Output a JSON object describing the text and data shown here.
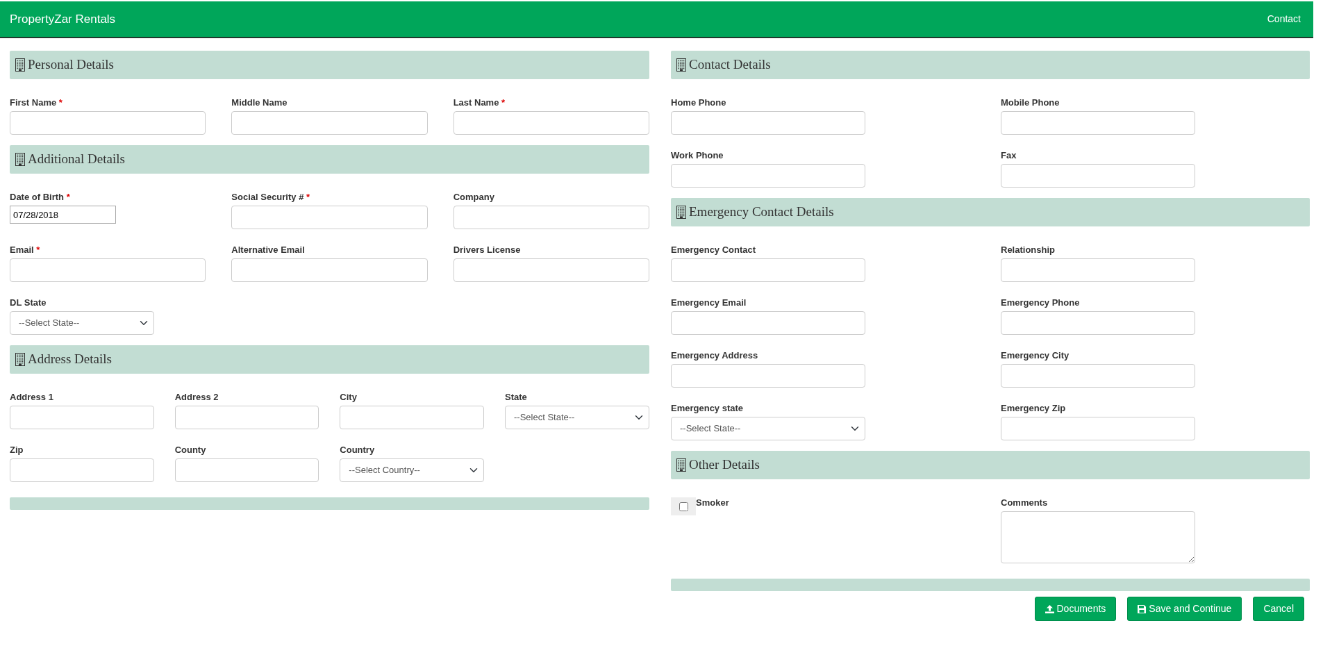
{
  "navbar": {
    "brand": "PropertyZar Rentals",
    "links": [
      "Contact"
    ]
  },
  "left_sections": [
    {
      "title": "Personal Details",
      "rows": [
        [
          {
            "kind": "text",
            "label": "First Name",
            "required_mark": "*"
          },
          {
            "kind": "text",
            "label": "Middle Name"
          },
          {
            "kind": "text",
            "label": "Last Name",
            "required_mark": "*"
          }
        ]
      ]
    },
    {
      "title": "Additional Details",
      "rows": [
        [
          {
            "kind": "date",
            "label": "Date of Birth",
            "required_mark": "*",
            "value": "07/28/2018"
          },
          {
            "kind": "text",
            "label": "Social Security #",
            "required_mark": "*"
          },
          {
            "kind": "text",
            "label": "Company"
          }
        ],
        [
          {
            "kind": "text",
            "label": "Email",
            "required_mark": "*"
          },
          {
            "kind": "text",
            "label": "Alternative Email"
          },
          {
            "kind": "text",
            "label": "Drivers License"
          }
        ],
        [
          {
            "kind": "select",
            "label": "DL State",
            "value": "--Select State--"
          }
        ]
      ]
    },
    {
      "title": "Address Details",
      "rows": [
        [
          {
            "kind": "text",
            "label": "Address 1"
          },
          {
            "kind": "text",
            "label": "Address 2"
          },
          {
            "kind": "text",
            "label": "City"
          },
          {
            "kind": "select",
            "label": "State",
            "value": "--Select State--"
          }
        ],
        [
          {
            "kind": "text",
            "label": "Zip"
          },
          {
            "kind": "text",
            "label": "County"
          },
          {
            "kind": "select",
            "label": "Country",
            "value": "--Select Country--"
          }
        ]
      ]
    }
  ],
  "right_sections": [
    {
      "title": "Contact Details",
      "rows": [
        [
          {
            "kind": "text",
            "label": "Home Phone"
          },
          {
            "kind": "text",
            "label": "Mobile Phone"
          }
        ],
        [
          {
            "kind": "text",
            "label": "Work Phone"
          },
          {
            "kind": "text",
            "label": "Fax"
          }
        ]
      ]
    },
    {
      "title": "Emergency Contact Details",
      "rows": [
        [
          {
            "kind": "text",
            "label": "Emergency Contact"
          },
          {
            "kind": "text",
            "label": "Relationship"
          }
        ],
        [
          {
            "kind": "text",
            "label": "Emergency Email"
          },
          {
            "kind": "text",
            "label": "Emergency Phone"
          }
        ],
        [
          {
            "kind": "text",
            "label": "Emergency Address"
          },
          {
            "kind": "text",
            "label": "Emergency City"
          }
        ],
        [
          {
            "kind": "select",
            "label": "Emergency state",
            "value": "--Select State--"
          },
          {
            "kind": "text",
            "label": "Emergency Zip"
          }
        ]
      ]
    },
    {
      "title": "Other Details",
      "rows": [
        [
          {
            "kind": "checkbox",
            "label": "Smoker",
            "checked": false
          },
          {
            "kind": "textarea",
            "label": "Comments"
          }
        ]
      ]
    }
  ],
  "buttons": [
    {
      "kind": "upload",
      "label": "Documents"
    },
    {
      "kind": "save",
      "label": "Save and Continue"
    },
    {
      "kind": "plain",
      "label": "Cancel"
    }
  ]
}
